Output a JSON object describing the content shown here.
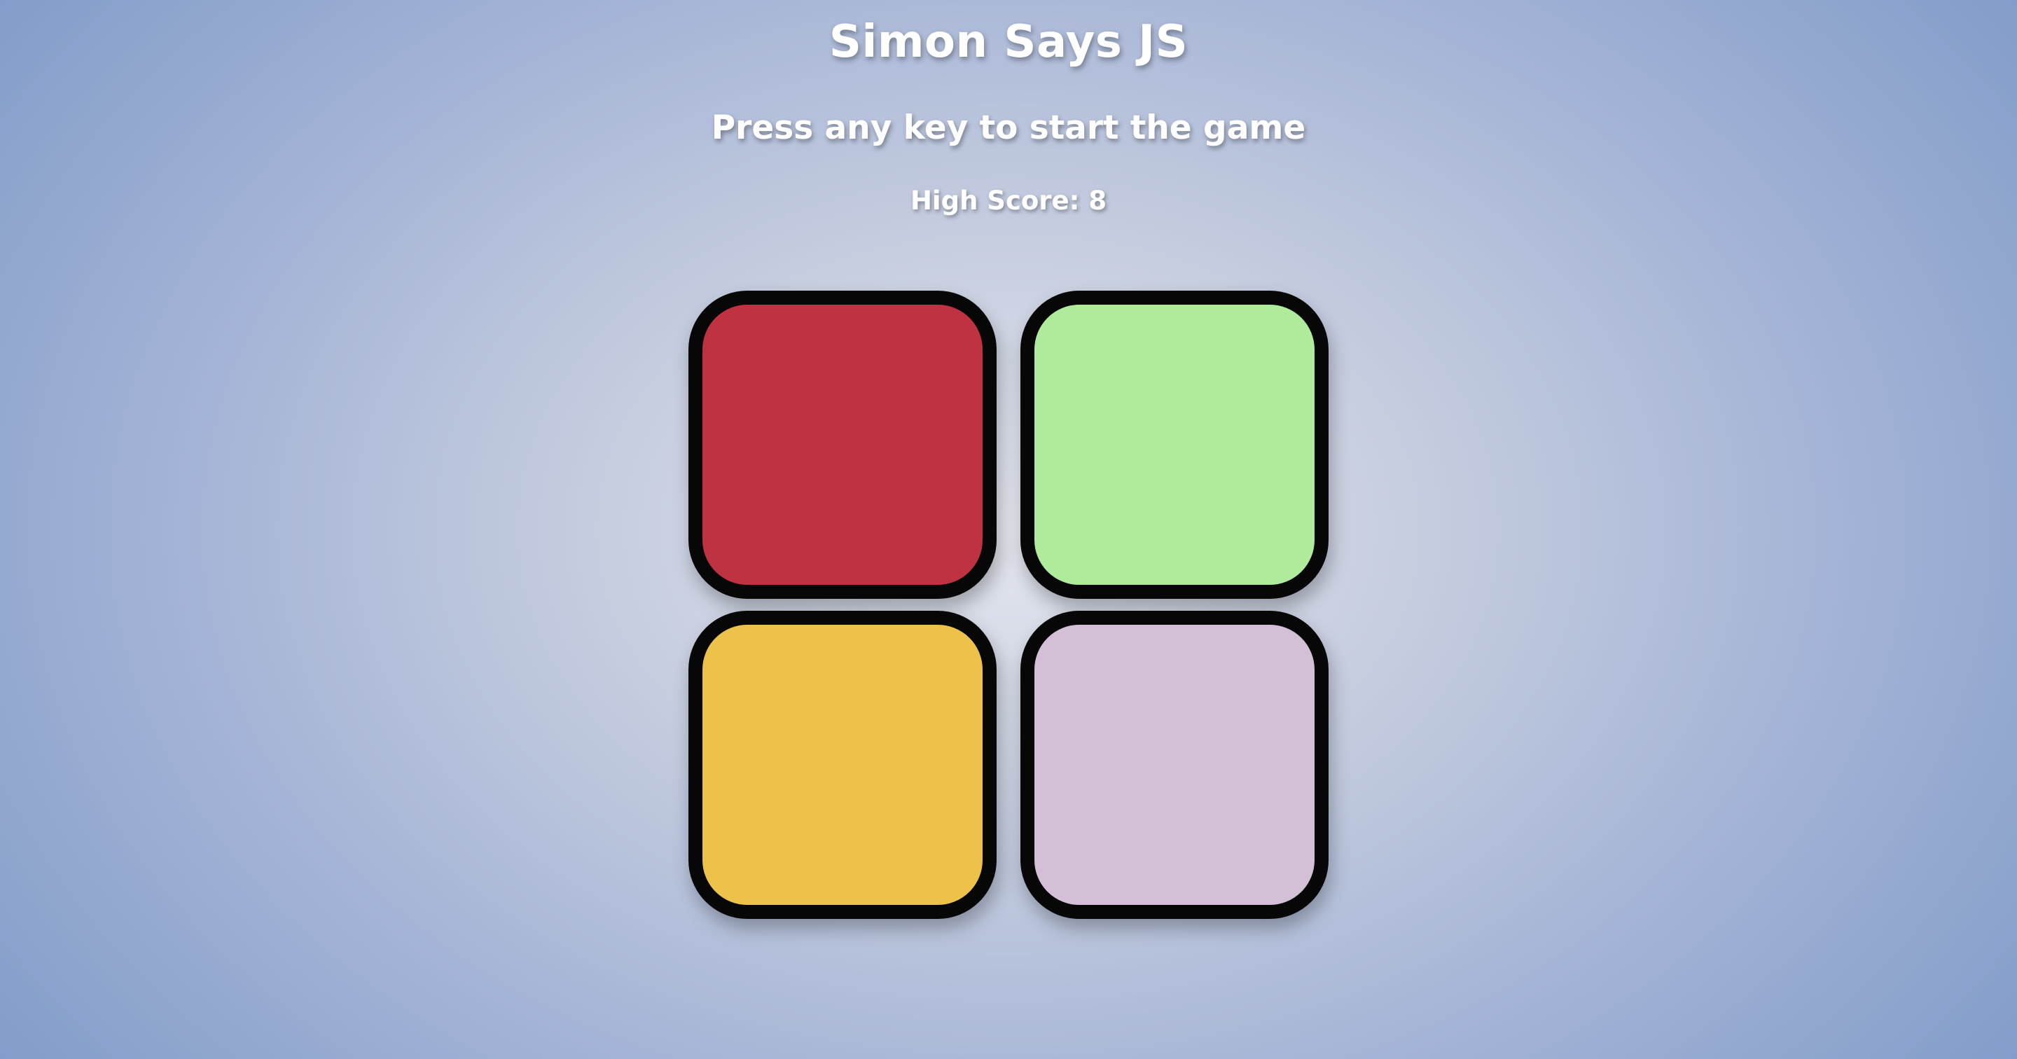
{
  "header": {
    "title": "Simon Says JS",
    "status": "Press any key to start the game",
    "high_score": "High Score: 8"
  },
  "board": {
    "pads": [
      {
        "id": "red",
        "color": "#bf3241"
      },
      {
        "id": "green",
        "color": "#afeb9b"
      },
      {
        "id": "yellow",
        "color": "#ecc24a"
      },
      {
        "id": "purple",
        "color": "#d3c0d7"
      }
    ]
  }
}
